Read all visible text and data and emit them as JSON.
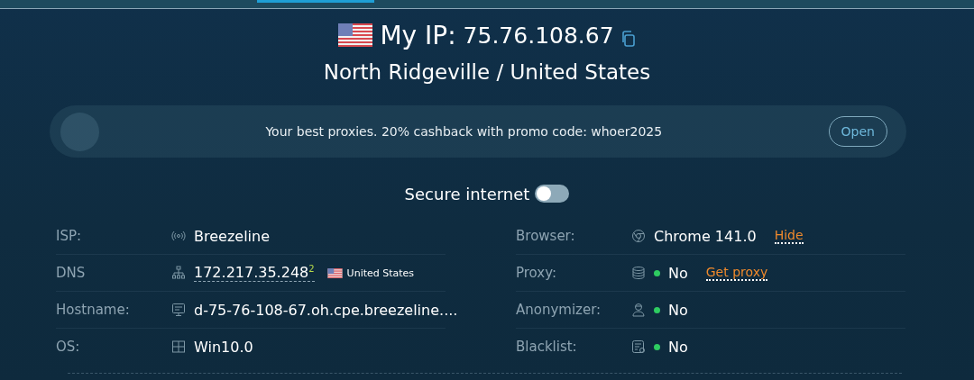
{
  "header": {
    "ip_label": "My IP:",
    "ip": "75.76.108.67",
    "location": "North Ridgeville / United States"
  },
  "promo": {
    "text": "Your best proxies. 20% cashback with promo code: whoer2025",
    "button": "Open"
  },
  "secure_internet": {
    "label": "Secure internet",
    "on": false
  },
  "left_rows": [
    {
      "kind": "text",
      "label": "ISP:",
      "value": "Breezeline"
    },
    {
      "kind": "dns",
      "label": "DNS",
      "value": "172.217.35.248",
      "sup": "2",
      "country": "United States"
    },
    {
      "kind": "text",
      "label": "Hostname:",
      "value": "d-75-76-108-67.oh.cpe.breezeline...."
    },
    {
      "kind": "text",
      "label": "OS:",
      "value": "Win10.0"
    }
  ],
  "right_rows": [
    {
      "kind": "text",
      "label": "Browser:",
      "value": "Chrome 141.0",
      "link": "Hide"
    },
    {
      "kind": "status",
      "label": "Proxy:",
      "value": "No",
      "link": "Get proxy"
    },
    {
      "kind": "status",
      "label": "Anonymizer:",
      "value": "No"
    },
    {
      "kind": "status",
      "label": "Blacklist:",
      "value": "No"
    }
  ]
}
